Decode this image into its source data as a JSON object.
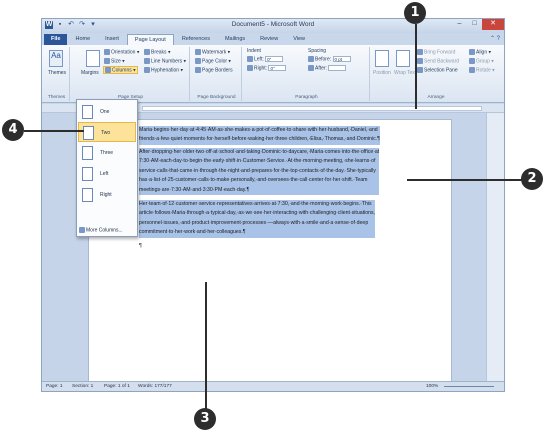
{
  "window": {
    "title": "Document5 - Microsoft Word",
    "help_icon": "help-icon"
  },
  "tabs": [
    "File",
    "Home",
    "Insert",
    "Page Layout",
    "References",
    "Mailings",
    "Review",
    "View"
  ],
  "ribbon": {
    "themes": {
      "label": "Themes",
      "group": "Themes"
    },
    "page_setup": {
      "group": "Page Setup",
      "margins": "Margins",
      "orientation": "Orientation ▾",
      "size": "Size ▾",
      "columns": "Columns ▾",
      "breaks": "Breaks ▾",
      "line_numbers": "Line Numbers ▾",
      "hyphenation": "Hyphenation ▾"
    },
    "page_background": {
      "group": "Page Background",
      "watermark": "Watermark ▾",
      "page_color": "Page Color ▾",
      "page_borders": "Page Borders"
    },
    "paragraph": {
      "group": "Paragraph",
      "indent": "Indent",
      "left_label": "Left:",
      "left_value": "0\"",
      "right_label": "Right:",
      "right_value": "0\"",
      "spacing": "Spacing",
      "before_label": "Before:",
      "before_value": "0 pt",
      "after_label": "After:",
      "after_value": ""
    },
    "arrange": {
      "group": "Arrange",
      "position": "Position",
      "wrap_text": "Wrap Text",
      "bring_forward": "Bring Forward",
      "send_backward": "Send Backward",
      "selection_pane": "Selection Pane",
      "align": "Align ▾",
      "group_btn": "Group ▾",
      "rotate": "Rotate ▾"
    }
  },
  "columns_menu": {
    "items": [
      "One",
      "Two",
      "Three",
      "Left",
      "Right"
    ],
    "selected": "Two",
    "more": "More Columns..."
  },
  "document": {
    "paragraphs": [
      [
        "Maria·begins·her·day·at·4:45·AM·as·she·makes·a·pot·of·coffee·to·share·with·her·husband,·Daniel,·and",
        "friends·a·few·quiet·moments·for·herself·before·waking·her·three·children,·Elisa,·Thomas,·and·Dominic.¶"
      ],
      [
        "After·dropping·her·older·two·off·at·school·and·taking·Dominic·to·daycare,·Maria·comes·into·the·office·at",
        "7:30·AM·each·day·to·begin·the·early·shift·in·Customer·Service.·At·the·morning·meeting,·she·learns·of",
        "service·calls·that·came·in·through·the·night·and·prepares·for·the·top·contacts·of·the·day.·She·typically",
        "has·a·list·of·25·customer·calls·to·make·personally,·and·oversees·the·call·center·for·her·shift.·Team",
        "meetings·are·7:30·AM·and·3:30·PM·each·day.¶"
      ],
      [
        "Her·team·of·12·customer·service·representatives·arrives·at·7:30,·and·the·morning·work·begins.·This",
        "article·follows·Maria·through·a·typical·day,·as·we·see·her·interacting·with·challenging·client·situations,",
        "personnel·issues,·and·product·improvement·processes·—always·with·a·smile·and·a·sense·of·deep",
        "commitment·to·her·work·and·her·colleagues.¶"
      ],
      [
        "¶"
      ]
    ]
  },
  "statusbar": {
    "page": "Page: 1",
    "section": "Section: 1",
    "page_of": "Page: 1 of 1",
    "words": "Words: 177/177",
    "zoom": "100%"
  },
  "callouts": [
    "1",
    "2",
    "3",
    "4"
  ],
  "colors": {
    "selection": "#a9c3e8",
    "file_tab": "#2b579a",
    "menu_highlight": "#fde39a",
    "callout": "#2d2d2d"
  }
}
